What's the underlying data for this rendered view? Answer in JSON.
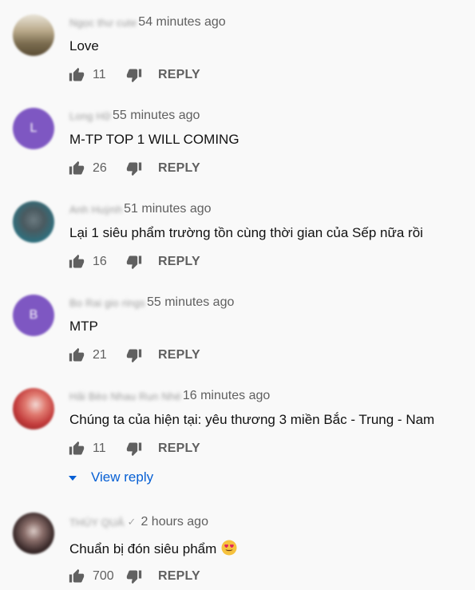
{
  "comments": [
    {
      "author": "Ngọc thư cute",
      "time": "54 minutes ago",
      "text": "Love",
      "likes": "11",
      "reply_label": "REPLY",
      "avatar_color": "#8a7a5c"
    },
    {
      "author": "Long Hữ",
      "time": "55 minutes ago",
      "text": "M-TP TOP 1 WILL COMING",
      "likes": "26",
      "reply_label": "REPLY",
      "avatar_color": "#7e57c2",
      "avatar_letter": "L"
    },
    {
      "author": "Anh Huỳnh",
      "time": "51 minutes ago",
      "text": "Lại 1 siêu phẩm trường tồn cùng thời gian của Sếp nữa rồi",
      "likes": "16",
      "reply_label": "REPLY",
      "avatar_color": "#3d7b8a"
    },
    {
      "author": "Bo Rai gio rings",
      "time": "55 minutes ago",
      "text": "MTP",
      "likes": "21",
      "reply_label": "REPLY",
      "avatar_color": "#7e57c2",
      "avatar_letter": "B"
    },
    {
      "author": "Hải Bèo Nhau Run Nhé",
      "time": "16 minutes ago",
      "text": "Chúng ta của hiện tại: yêu thương 3 miền Bắc - Trung - Nam",
      "likes": "11",
      "reply_label": "REPLY",
      "avatar_color": "#c23b3b",
      "view_reply": "View reply"
    },
    {
      "author": "THÚY QUẢ",
      "time": "2 hours ago",
      "text": "Chuẩn bị đón siêu phẩm",
      "likes": "700",
      "reply_label": "REPLY",
      "avatar_color": "#3a2a2a"
    }
  ],
  "colors": {
    "background": "#f9f9f9",
    "link_blue": "#065fd4",
    "meta_gray": "#606060",
    "icon_gray": "#606060"
  },
  "icons": [
    "thumbs-up-icon",
    "thumbs-down-icon",
    "chevron-down-icon",
    "heart-eyes-emoji",
    "verified-check-icon"
  ]
}
